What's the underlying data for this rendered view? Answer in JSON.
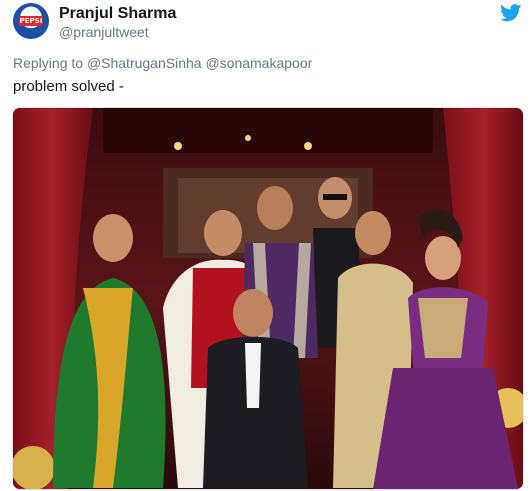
{
  "tweet": {
    "author_name": "Pranjul Sharma",
    "author_handle": "@pranjultweet",
    "avatar_label": "PEPSI",
    "replying_prefix": "Replying to",
    "replying_to": [
      "@ShatruganSinha",
      "@sonamakapoor"
    ],
    "text": "problem solved -"
  },
  "icons": {
    "platform": "twitter-bird-icon"
  },
  "colors": {
    "twitter_blue": "#1da1f2",
    "handle_gray": "#657786",
    "text": "#14171a"
  }
}
